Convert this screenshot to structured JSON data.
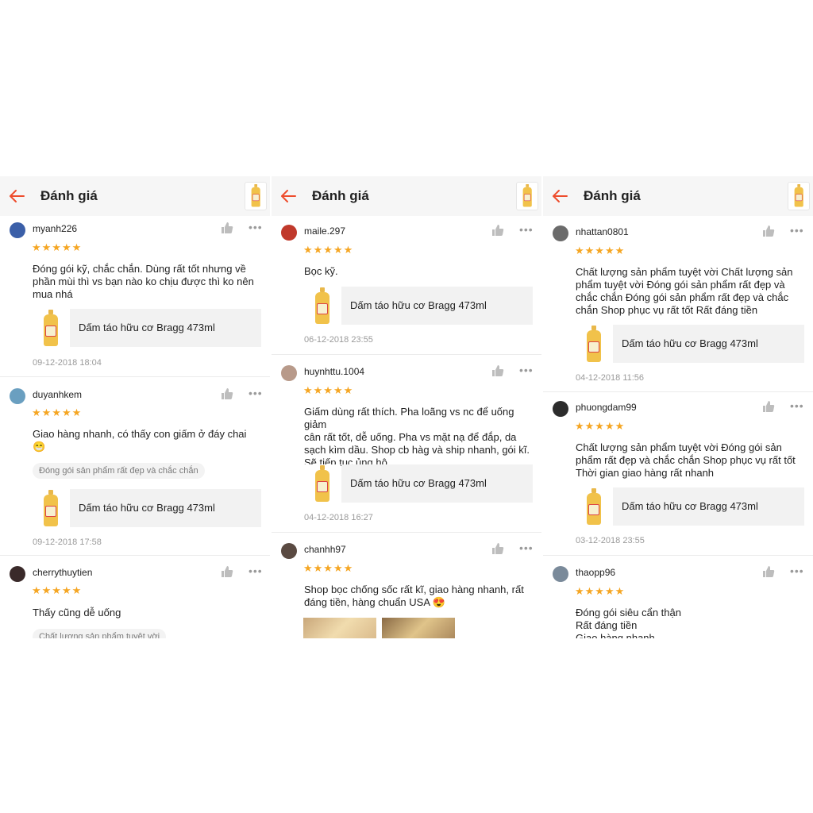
{
  "header": {
    "title": "Đánh giá"
  },
  "product_name": "Dấm táo hữu cơ Bragg 473ml",
  "colors": {
    "accent": "#ee4d2d",
    "star": "#f5a623"
  },
  "stars": "★★★★★",
  "more": "•••",
  "panels": [
    {
      "reviews": [
        {
          "username": "myanh226",
          "text": "Đóng gói kỹ, chắc chắn. Dùng rất tốt nhưng về\nphần mùi thì vs bạn nào ko chịu được thì ko nên\nmua nhá",
          "date": "09-12-2018 18:04"
        },
        {
          "username": "duyanhkem",
          "text": "Giao hàng nhanh, có thấy con giấm ở đáy chai\n😁",
          "tag": "Đóng gói sản phẩm rất đẹp và chắc chắn",
          "date": "09-12-2018 17:58"
        },
        {
          "username": "cherrythuytien",
          "text": "Thấy cũng dễ uống",
          "tag": "Chất lượng sản phẩm tuyệt vời"
        }
      ]
    },
    {
      "reviews": [
        {
          "username": "maile.297",
          "text": "Bọc kỹ.",
          "date": "06-12-2018 23:55"
        },
        {
          "username": "huynhttu.1004",
          "text": "Giấm dùng rất thích. Pha loãng vs nc để uống giảm\ncân rất tốt, dễ uống. Pha vs mặt nạ để đắp, da\nsạch kìm dầu. Shop cb hàg và ship nhanh, gói kĩ.\nSẽ tiếp tục ủng hộ",
          "date": "04-12-2018 16:27"
        },
        {
          "username": "chanhh97",
          "text": "Shop bọc chống sốc rất kĩ, giao hàng nhanh, rất\nđáng tiền, hàng chuẩn USA 😍"
        }
      ]
    },
    {
      "reviews": [
        {
          "username": "nhattan0801",
          "text": " Chất lượng sản phẩm tuyệt vời Chất lượng sản\nphẩm tuyệt vời Đóng gói sản phẩm rất đẹp và\nchắc chắn Đóng gói sản phẩm rất đẹp và chắc\nchắn Shop phục vụ rất tốt Rất đáng tiền",
          "date": "04-12-2018 11:56"
        },
        {
          "username": "phuongdam99",
          "text": " Chất lượng sản phẩm tuyệt vời Đóng gói sản\nphẩm rất đẹp và chắc chắn Shop phục vụ rất tốt\nThời gian giao hàng rất nhanh",
          "date": "03-12-2018 23:55"
        },
        {
          "username": "thaopp96",
          "text": "Đóng gói siêu cẩn thận\nRất đáng tiền\nGiao hàng nhanh"
        }
      ]
    }
  ]
}
